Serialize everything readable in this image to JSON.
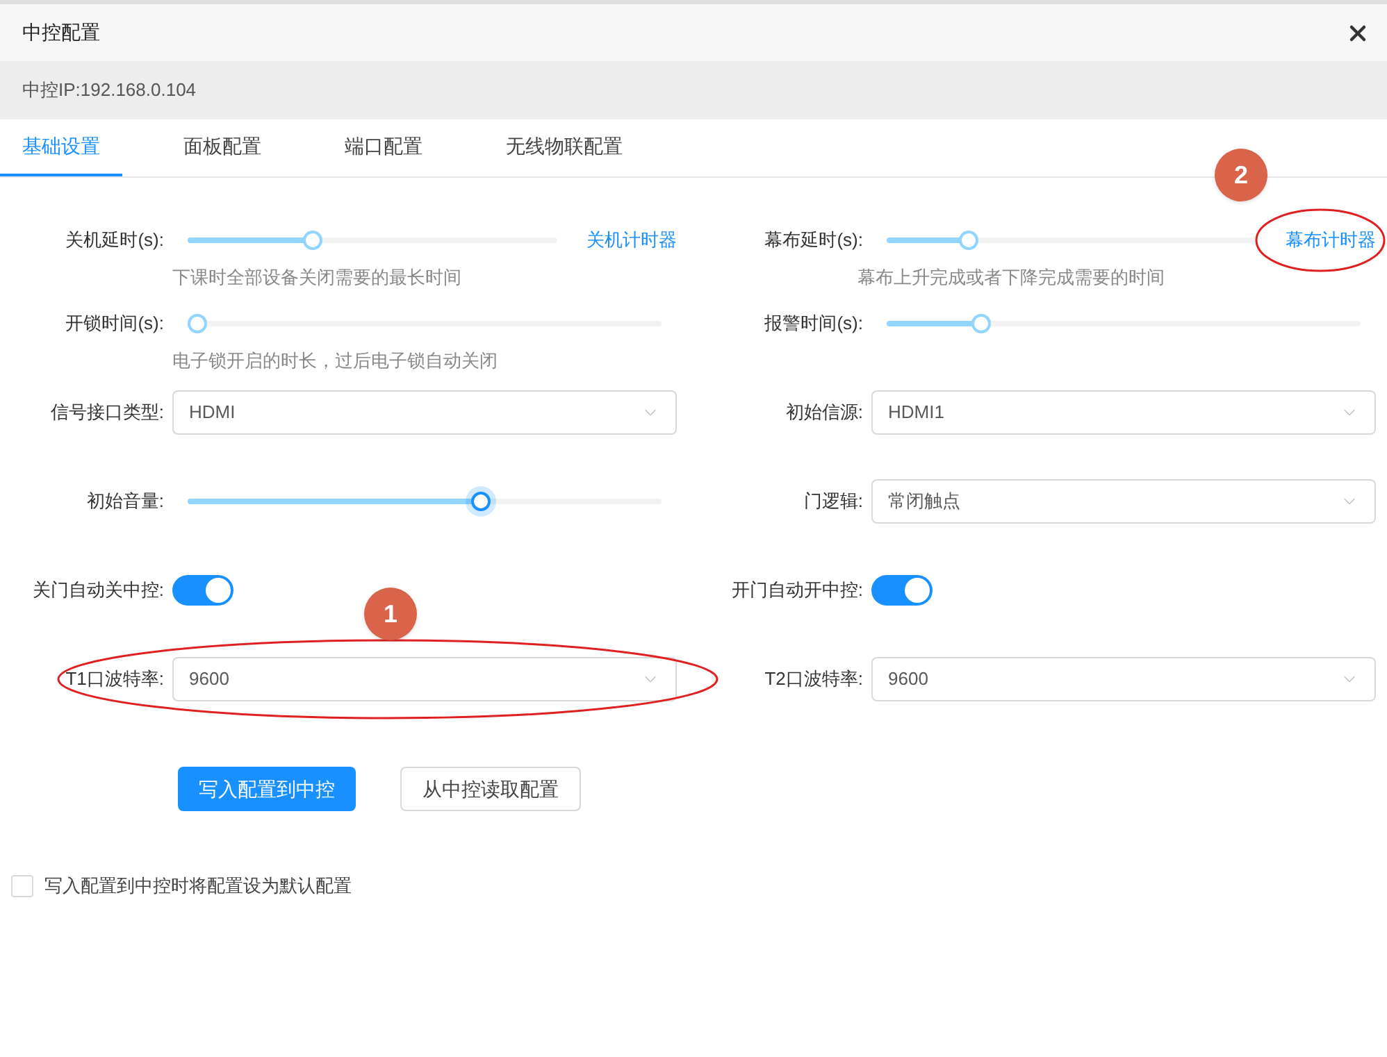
{
  "dialog": {
    "title": "中控配置",
    "ip_label": "中控IP:192.168.0.104"
  },
  "tabs": [
    {
      "label": "基础设置",
      "selected": true
    },
    {
      "label": "面板配置",
      "selected": false
    },
    {
      "label": "端口配置",
      "selected": false
    },
    {
      "label": "无线物联配置",
      "selected": false
    }
  ],
  "rows": [
    {
      "left": {
        "kind": "slider",
        "label": "关机延时(s):",
        "level": 0.34,
        "focused": false,
        "link": "关机计时器",
        "hint": "下课时全部设备关闭需要的最长时间"
      },
      "right": {
        "kind": "slider",
        "label": "幕布延时(s):",
        "level": 0.22,
        "focused": false,
        "link": "幕布计时器",
        "hint": "幕布上升完成或者下降完成需要的时间"
      }
    },
    {
      "left": {
        "kind": "slider",
        "label": "开锁时间(s):",
        "level": 0.02,
        "focused": false,
        "hint": "电子锁开启的时长，过后电子锁自动关闭"
      },
      "right": {
        "kind": "slider",
        "label": "报警时间(s):",
        "level": 0.2,
        "focused": false
      }
    },
    {
      "left": {
        "kind": "select",
        "label": "信号接口类型:",
        "value": "HDMI"
      },
      "right": {
        "kind": "select",
        "label": "初始信源:",
        "value": "HDMI1"
      }
    },
    {
      "left": {
        "kind": "slider",
        "label": "初始音量:",
        "level": 0.62,
        "focused": true
      },
      "right": {
        "kind": "select",
        "label": "门逻辑:",
        "value": "常闭触点"
      }
    },
    {
      "left": {
        "kind": "toggle",
        "label": "关门自动关中控:",
        "on": true
      },
      "right": {
        "kind": "toggle",
        "label": "开门自动开中控:",
        "on": true
      }
    },
    {
      "left": {
        "kind": "select",
        "label": "T1口波特率:",
        "value": "9600"
      },
      "right": {
        "kind": "select",
        "label": "T2口波特率:",
        "value": "9600"
      }
    }
  ],
  "buttons": [
    {
      "label": "写入配置到中控",
      "primary": true
    },
    {
      "label": "从中控读取配置",
      "primary": false
    }
  ],
  "default_checkbox": {
    "label": "写入配置到中控时将配置设为默认配置",
    "checked": false
  },
  "annotations": [
    {
      "label": "1"
    },
    {
      "label": "2"
    }
  ]
}
